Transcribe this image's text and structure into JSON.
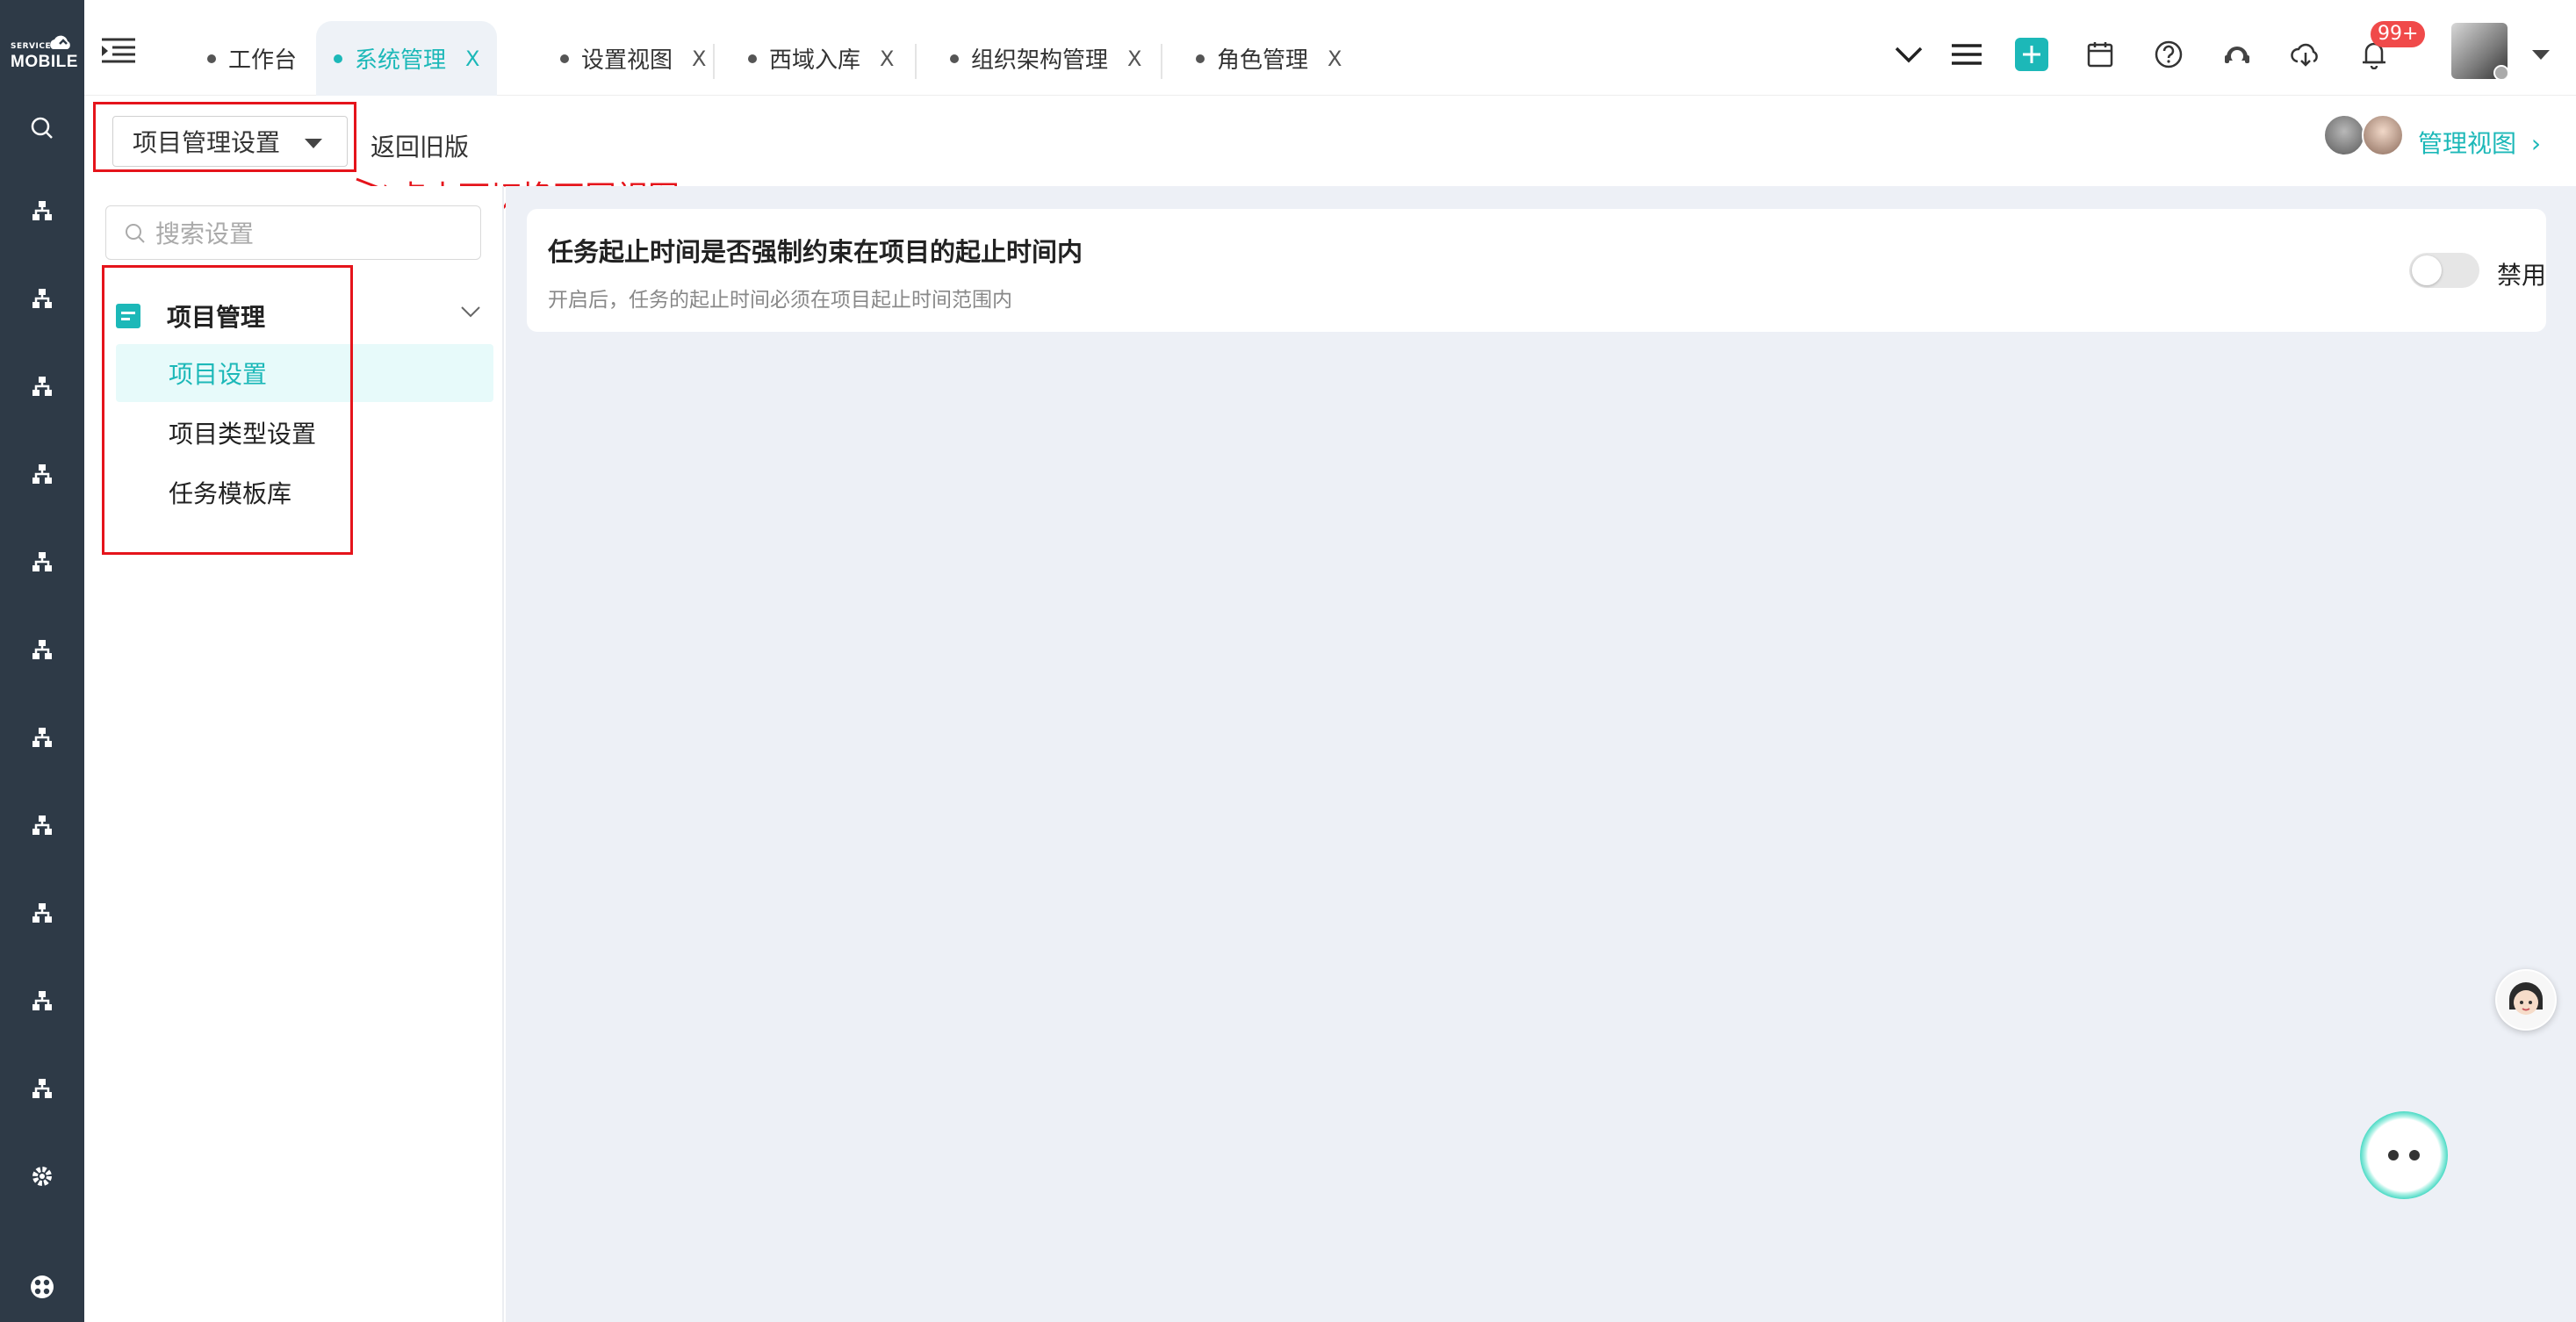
{
  "logo": {
    "small": "SERVICE",
    "big": "MOBILE"
  },
  "tabs": [
    {
      "label": "工作台",
      "active": false,
      "closable": false
    },
    {
      "label": "系统管理",
      "active": true,
      "closable": true
    },
    {
      "label": "设置视图",
      "active": false,
      "closable": true
    },
    {
      "label": "西域入库",
      "active": false,
      "closable": true
    },
    {
      "label": "组织架构管理",
      "active": false,
      "closable": true
    },
    {
      "label": "角色管理",
      "active": false,
      "closable": true
    }
  ],
  "tab_close_glyph": "X",
  "notifications": {
    "badge": "99+"
  },
  "subbar": {
    "view_select": "项目管理设置",
    "back_old": "返回旧版",
    "manage_view": "管理视图",
    "manage_view_chevron": "›"
  },
  "annotation": {
    "text": "点击可切换不同视图"
  },
  "left_panel": {
    "search_placeholder": "搜索设置",
    "group_title": "项目管理",
    "items": [
      {
        "label": "项目设置",
        "active": true
      },
      {
        "label": "项目类型设置",
        "active": false
      },
      {
        "label": "任务模板库",
        "active": false
      }
    ]
  },
  "setting_card": {
    "title": "任务起止时间是否强制约束在项目的起止时间内",
    "description": "开启后，任务的起止时间必须在项目起止时间范围内",
    "toggle_on": false,
    "toggle_label": "禁用"
  },
  "colors": {
    "accent": "#1cb8b8",
    "sidebar": "#2e3a47",
    "annotation_red": "#e5141b",
    "badge_red": "#f04a4a",
    "main_bg": "#edf0f6"
  }
}
